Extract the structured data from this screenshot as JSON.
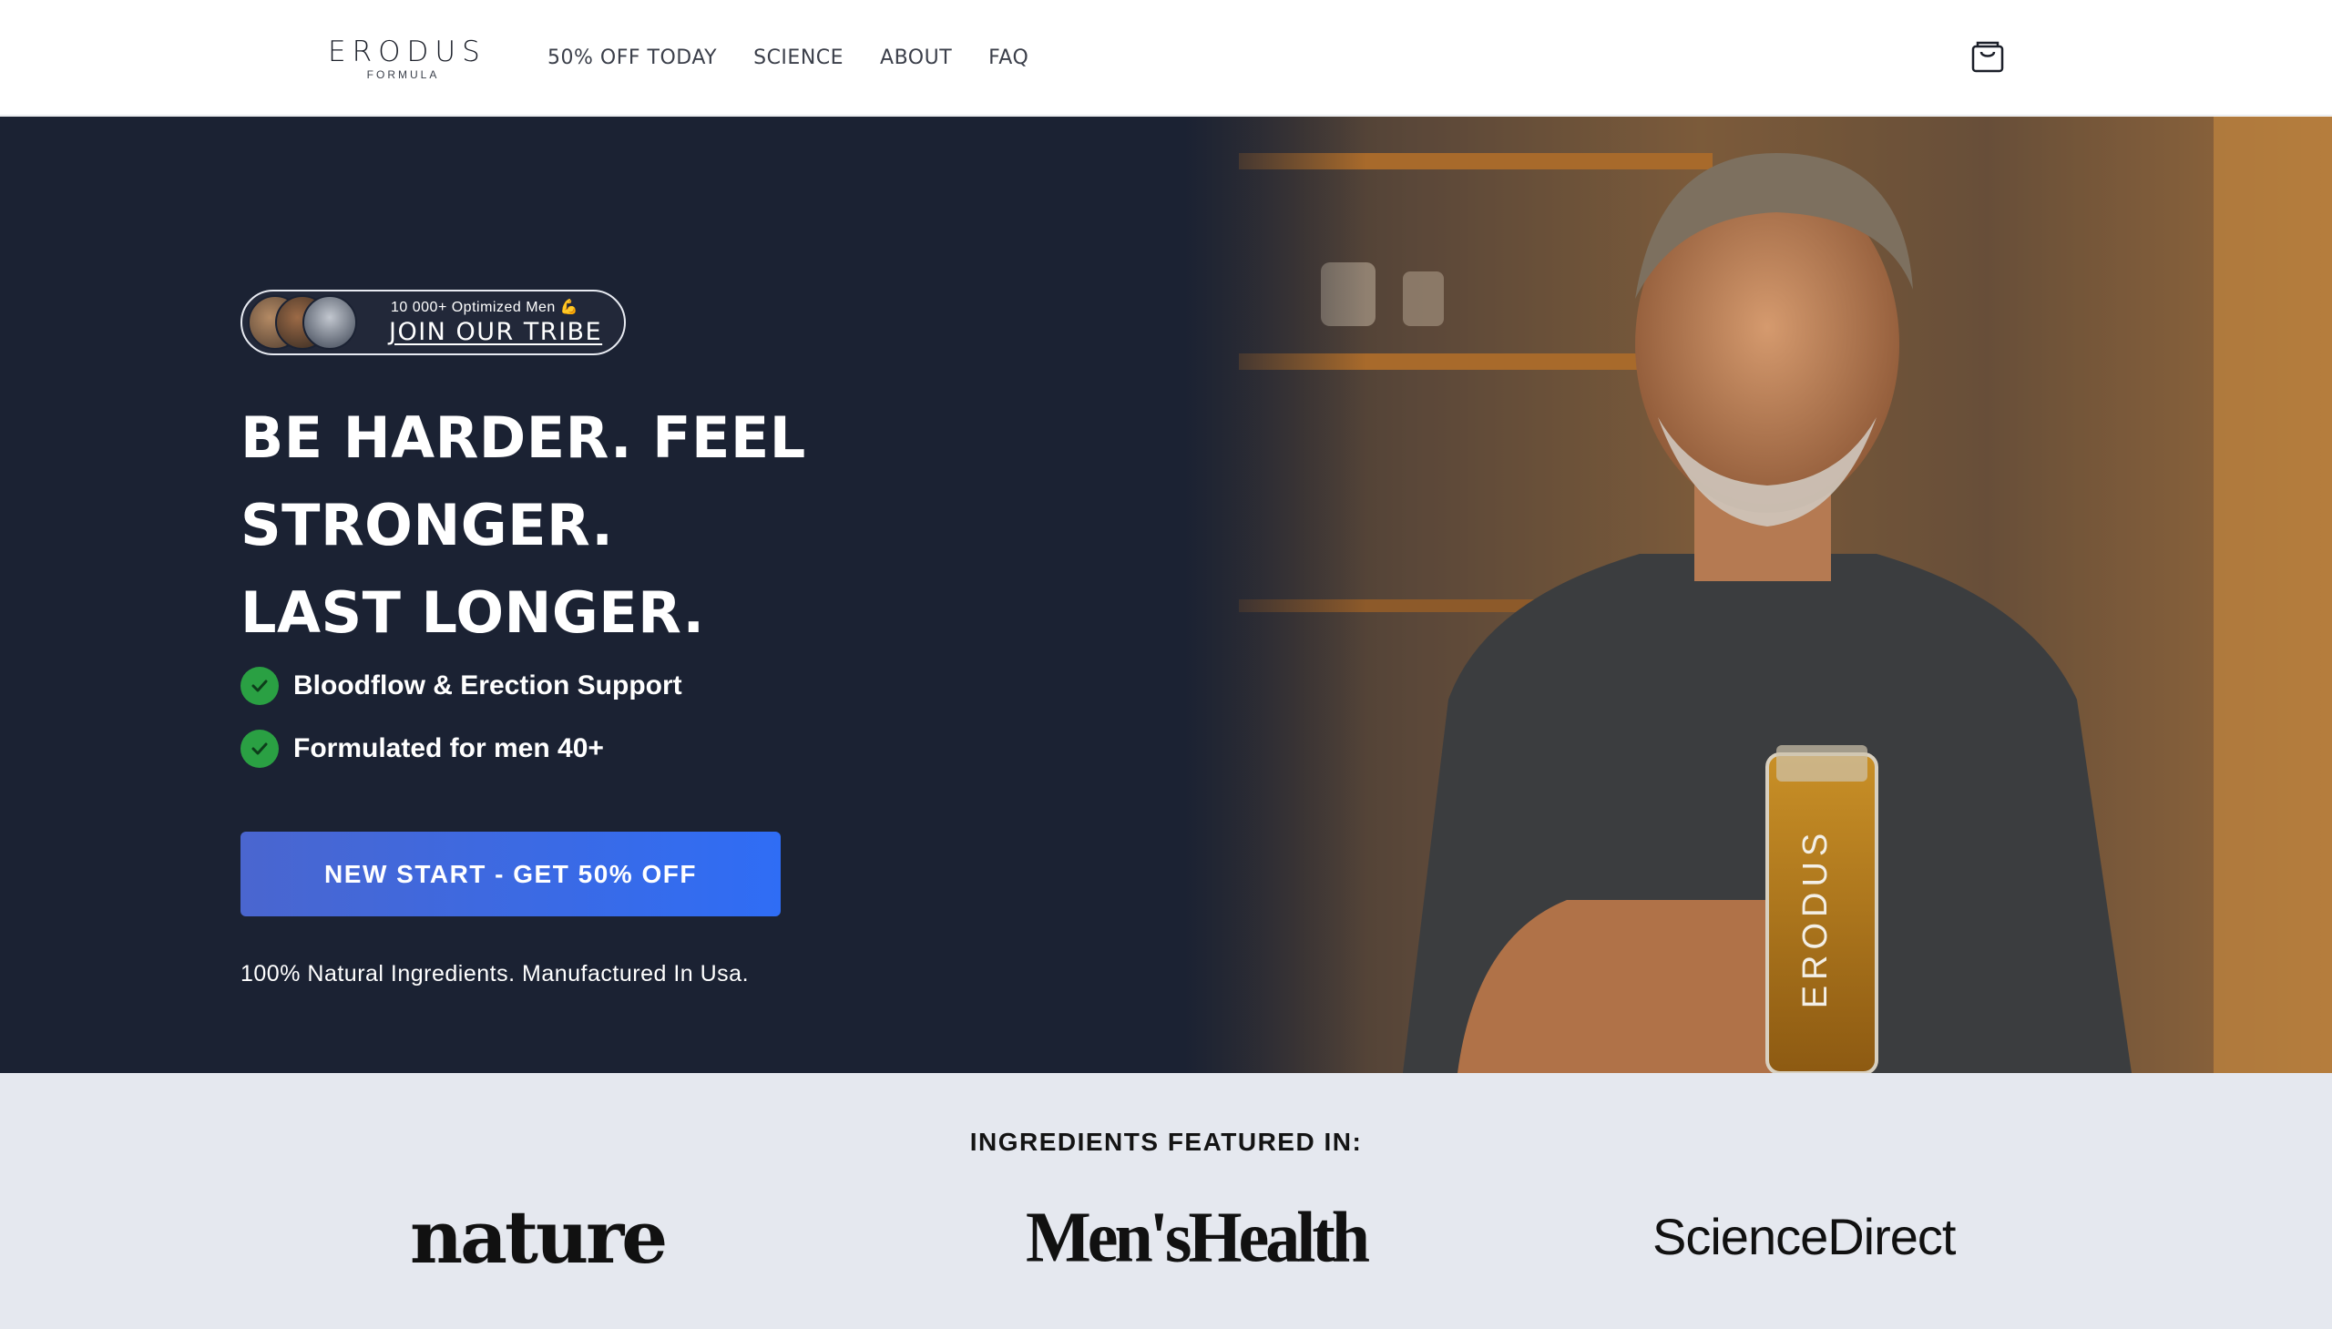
{
  "header": {
    "logo_main": "ERODUS",
    "logo_sub": "FORMULA",
    "nav": [
      "50% OFF TODAY",
      "SCIENCE",
      "ABOUT",
      "FAQ"
    ],
    "cart_icon": "shopping-bag-icon"
  },
  "hero": {
    "tribe_count": "10 000+ Optimized Men 💪",
    "tribe_cta": "JOIN OUR TRIBE",
    "headline_line1": "BE HARDER. FEEL STRONGER.",
    "headline_line2": "LAST LONGER.",
    "benefits": [
      "Bloodflow & Erection Support",
      "Formulated for men 40+"
    ],
    "cta_label": "NEW START - GET 50% OFF",
    "natural_note": "100% Natural Ingredients. Manufactured In Usa.",
    "bottle_label": "ERODUS",
    "colors": {
      "bg": "#1b2233",
      "check": "#2aa043",
      "cta_start": "#4a66cf",
      "cta_end": "#2f6df5"
    }
  },
  "featured": {
    "title": "INGREDIENTS FEATURED IN:",
    "logos": [
      "nature",
      "Men'sHealth",
      "ScienceDirect"
    ]
  }
}
